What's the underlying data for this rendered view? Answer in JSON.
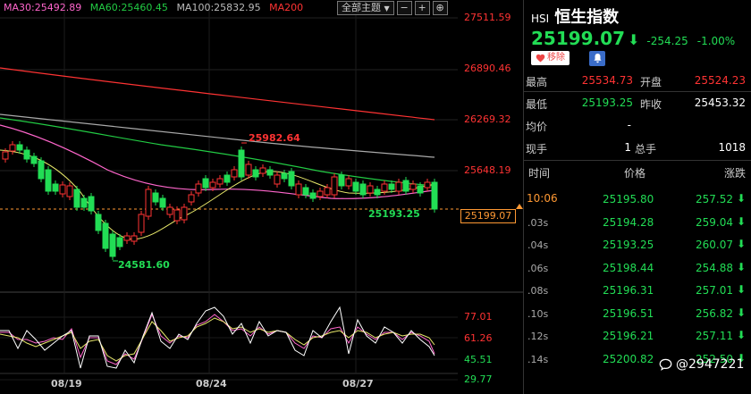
{
  "ma_legend": [
    {
      "label": "MA30:25492.89",
      "color": "#ff66cc"
    },
    {
      "label": "MA60:25460.45",
      "color": "#22cc44"
    },
    {
      "label": "MA100:25832.95",
      "color": "#bbbbbb"
    },
    {
      "label": "MA200",
      "color": "#ff3333"
    }
  ],
  "toolbar": {
    "theme_label": "全部主题",
    "theme_arrow": "▼",
    "minus": "−",
    "plus": "+",
    "pin": "⊕"
  },
  "price_axis": [
    {
      "label": "27511.59",
      "color": "#ff3333"
    },
    {
      "label": "26890.46",
      "color": "#ff3333"
    },
    {
      "label": "26269.32",
      "color": "#ff3333"
    },
    {
      "label": "25648.19",
      "color": "#ff3333"
    },
    {
      "label": "77.01",
      "color": "#ff3333"
    },
    {
      "label": "61.26",
      "color": "#ff3333"
    },
    {
      "label": "45.51",
      "color": "#22dd55"
    },
    {
      "label": "29.77",
      "color": "#22dd55"
    }
  ],
  "current_price_tag": "25199.07",
  "callouts": {
    "high": "25982.64",
    "low": "24581.60",
    "close": "25193.25"
  },
  "dates": [
    "08/19",
    "08/24",
    "08/27"
  ],
  "quote": {
    "symbol": "HSI",
    "name": "恒生指数",
    "price": "25199.07",
    "arrow": "⬇",
    "change": "-254.25",
    "change_pct": "-1.00%",
    "remove_label": "移除",
    "heart_icon": "heart-icon",
    "bell_icon": "bell-icon"
  },
  "stats": [
    {
      "label": "最高",
      "value": "25534.73",
      "value_color": "#ff3333",
      "label2": "开盘",
      "value2": "25524.23",
      "value2_color": "#ff3333"
    },
    {
      "label": "最低",
      "value": "25193.25",
      "value_color": "#22dd55",
      "label2": "昨收",
      "value2": "25453.32",
      "value2_color": "#ffffff"
    },
    {
      "label": "均价",
      "value": "-",
      "value_color": "#ffffff",
      "label2": "",
      "value2": "",
      "value2_color": "#ffffff"
    },
    {
      "label": "现手",
      "value": "1",
      "value_color": "#ffffff",
      "label2": "总手",
      "value2": "1018",
      "value2_color": "#ffffff"
    }
  ],
  "ticks_header": {
    "time": "时间",
    "price": "价格",
    "change": "涨跌"
  },
  "ticks": [
    {
      "time": "10:06",
      "price": "25195.80",
      "change": "257.52"
    },
    {
      "time": ".03s",
      "price": "25194.28",
      "change": "259.04"
    },
    {
      "time": ".04s",
      "price": "25193.25",
      "change": "260.07"
    },
    {
      "time": ".06s",
      "price": "25198.44",
      "change": "254.88"
    },
    {
      "time": ".08s",
      "price": "25196.31",
      "change": "257.01"
    },
    {
      "time": ".10s",
      "price": "25196.51",
      "change": "256.82"
    },
    {
      "time": ".12s",
      "price": "25196.21",
      "change": "257.11"
    },
    {
      "time": ".14s",
      "price": "25200.82",
      "change": "252.50"
    }
  ],
  "watermark": "@2947221",
  "chart_data": {
    "type": "candlestick",
    "price_ticks": [
      27511.59,
      26890.46,
      26269.32,
      25648.19
    ],
    "indicator_ticks": [
      77.01,
      61.26,
      45.51,
      29.77
    ],
    "high_label": 25982.64,
    "low_label": 24581.6,
    "last_price": 25199.07,
    "ma_lines": [
      "MA30",
      "MA60",
      "MA100",
      "MA200"
    ]
  },
  "colors": {
    "up": "#ff3333",
    "down": "#22dd55",
    "bg": "#000000",
    "accent": "#ff9933"
  }
}
